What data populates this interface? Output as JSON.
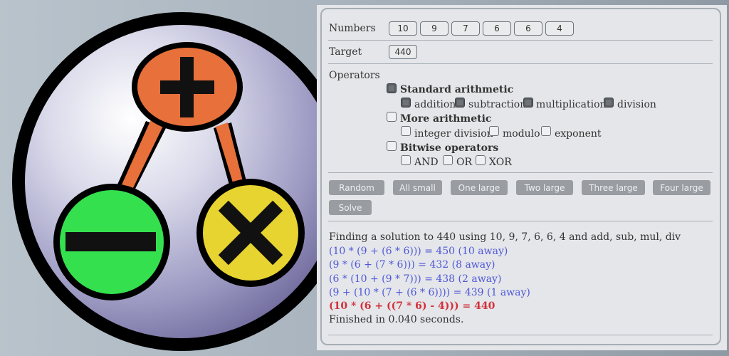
{
  "form": {
    "numbers_label": "Numbers",
    "numbers": [
      "10",
      "9",
      "7",
      "6",
      "6",
      "4"
    ],
    "target_label": "Target",
    "target": "440",
    "operators_label": "Operators"
  },
  "operators": {
    "standard": {
      "label": "Standard arithmetic",
      "checked": true,
      "items": [
        {
          "label": "addition",
          "checked": true
        },
        {
          "label": "subtraction",
          "checked": true
        },
        {
          "label": "multiplication",
          "checked": true
        },
        {
          "label": "division",
          "checked": true
        }
      ]
    },
    "more": {
      "label": "More arithmetic",
      "checked": false,
      "items": [
        {
          "label": "integer division",
          "checked": false
        },
        {
          "label": "modulo",
          "checked": false
        },
        {
          "label": "exponent",
          "checked": false
        }
      ]
    },
    "bitwise": {
      "label": "Bitwise operators",
      "checked": false,
      "items": [
        {
          "label": "AND",
          "checked": false
        },
        {
          "label": "OR",
          "checked": false
        },
        {
          "label": "XOR",
          "checked": false
        }
      ]
    }
  },
  "buttons": {
    "random": "Random",
    "all_small": "All small",
    "one_large": "One large",
    "two_large": "Two large",
    "three_large": "Three large",
    "four_large": "Four large",
    "solve": "Solve"
  },
  "output": {
    "lines": [
      "Finding a solution to 440 using 10, 9, 7, 6, 6, 4 and add, sub, mul, div",
      "(10 * (9 + (6 * 6))) = 450 (10 away)",
      "(9 * (6 + (7 * 6))) = 432 (8 away)",
      "(6 * (10 + (9 * 7))) = 438 (2 away)",
      "(9 + (10 * (7 + (6 * 6)))) = 439 (1 away)",
      "(10 * (6 + ((7 * 6) - 4))) = 440",
      "Finished in 0.040 seconds."
    ]
  },
  "logo": {
    "icons": [
      "plus-icon",
      "minus-icon",
      "multiply-icon"
    ],
    "colors": {
      "plus": "#e8703a",
      "minus": "#35e04f",
      "multiply": "#e7d431",
      "ring": "#000000"
    }
  }
}
